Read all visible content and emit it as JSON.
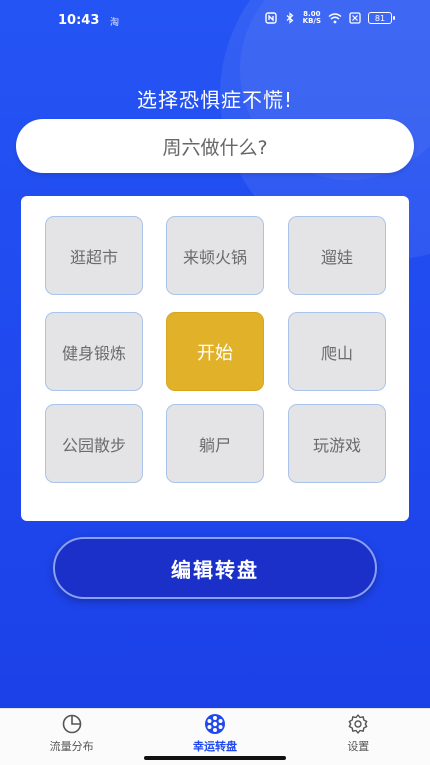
{
  "status_bar": {
    "time": "10:43",
    "small_label": "淘",
    "net_speed_top": "8.00",
    "net_speed_bottom": "KB/S",
    "battery": "81"
  },
  "headline": "选择恐惧症不慌!",
  "question": "周六做什么?",
  "wheel": {
    "items": [
      "逛超市",
      "来顿火锅",
      "遛娃",
      "健身锻炼",
      "开始",
      "爬山",
      "公园散步",
      "躺尸",
      "玩游戏"
    ]
  },
  "edit_button_label": "编辑转盘",
  "bottom_nav": {
    "items": [
      {
        "label": "流量分布",
        "icon": "pie-chart-icon"
      },
      {
        "label": "幸运转盘",
        "icon": "wheel-icon"
      },
      {
        "label": "设置",
        "icon": "gear-icon"
      }
    ],
    "active_index": 1
  },
  "colors": {
    "background": "#2554f4",
    "start_cell": "#e2b12a",
    "button": "#1b2fc9",
    "nav_active": "#1f48ee"
  }
}
